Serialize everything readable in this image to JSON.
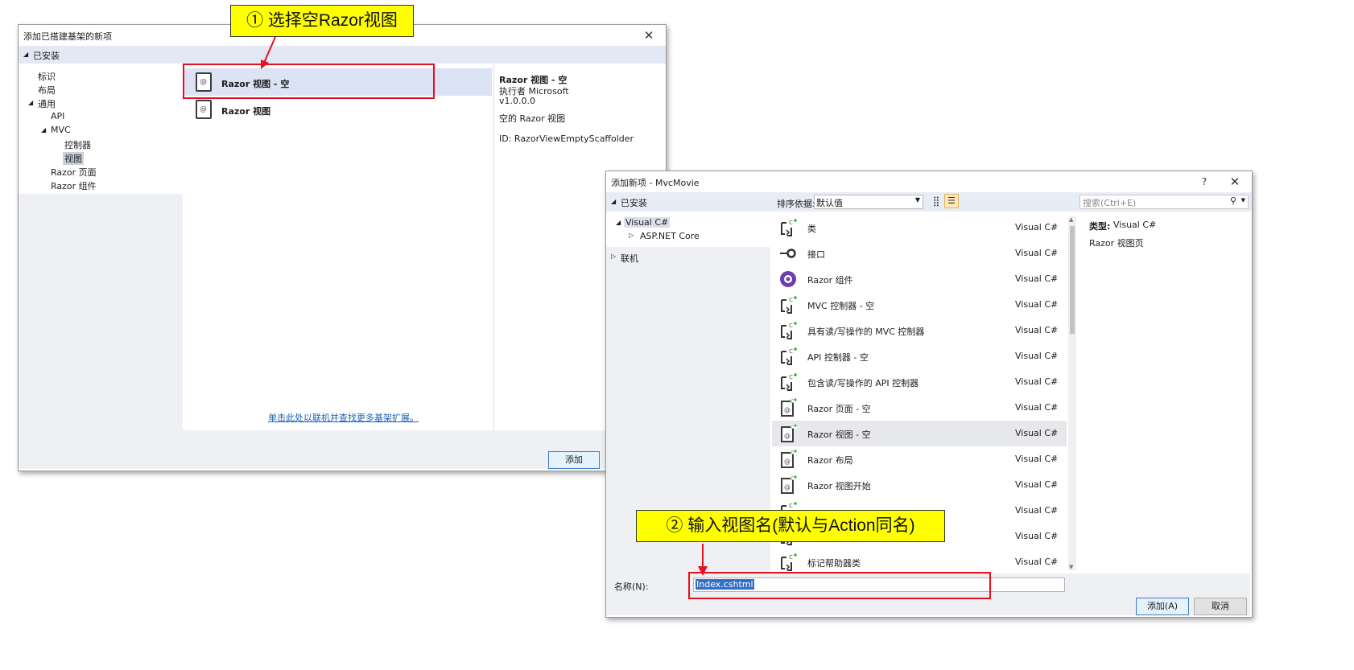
{
  "colors": {
    "accent_red": "#e8101c",
    "callout_yellow": "#ffff00",
    "selection_blue": "#dbe3f5",
    "link_blue": "#1a5fb4",
    "text_selection": "#3370c4"
  },
  "callouts": {
    "step1": "① 选择空Razor视图",
    "step2": "② 输入视图名(默认与Action同名)"
  },
  "scaffold": {
    "title": "添加已搭建基架的新项",
    "close_icon": "close-icon",
    "installed": "已安装",
    "tree": [
      "标识",
      "布局",
      "通用",
      "API",
      "MVC",
      "控制器",
      "视图",
      "Razor 页面",
      "Razor 组件"
    ],
    "items": [
      {
        "label": "Razor 视图 - 空",
        "icon": "razor-file-icon"
      },
      {
        "label": "Razor 视图",
        "icon": "razor-file-icon"
      }
    ],
    "detail": {
      "name": "Razor 视图 - 空",
      "author": "执行者 Microsoft",
      "version": "v1.0.0.0",
      "description": "空的 Razor 视图",
      "id": "ID: RazorViewEmptyScaffolder"
    },
    "online_link": "单击此处以联机并查找更多基架扩展。",
    "add_button": "添加"
  },
  "addnew": {
    "title": "添加新项 - MvcMovie",
    "help": "?",
    "close": "✕",
    "installed": "已安装",
    "sort_label": "排序依据:",
    "sort_value": "默认值",
    "search_placeholder": "搜索(Ctrl+E)",
    "tree": {
      "visual_csharp": "Visual C#",
      "aspnet_core": "ASP.NET Core",
      "online": "联机"
    },
    "templates": [
      {
        "name": "类",
        "lang": "Visual C#",
        "icon": "csharp-class-icon"
      },
      {
        "name": "接口",
        "lang": "Visual C#",
        "icon": "interface-icon"
      },
      {
        "name": "Razor 组件",
        "lang": "Visual C#",
        "icon": "blazor-icon"
      },
      {
        "name": "MVC 控制器 - 空",
        "lang": "Visual C#",
        "icon": "csharp-class-icon"
      },
      {
        "name": "具有读/写操作的 MVC 控制器",
        "lang": "Visual C#",
        "icon": "csharp-class-icon"
      },
      {
        "name": "API 控制器 - 空",
        "lang": "Visual C#",
        "icon": "csharp-class-icon"
      },
      {
        "name": "包含读/写操作的 API 控制器",
        "lang": "Visual C#",
        "icon": "csharp-class-icon"
      },
      {
        "name": "Razor 页面 - 空",
        "lang": "Visual C#",
        "icon": "razor-file-icon"
      },
      {
        "name": "Razor 视图 - 空",
        "lang": "Visual C#",
        "icon": "razor-file-icon"
      },
      {
        "name": "Razor 布局",
        "lang": "Visual C#",
        "icon": "razor-file-icon"
      },
      {
        "name": "Razor 视图开始",
        "lang": "Visual C#",
        "icon": "razor-file-icon"
      },
      {
        "name": "",
        "lang": "Visual C#",
        "icon": "csharp-class-icon"
      },
      {
        "name": "",
        "lang": "Visual C#",
        "icon": "csharp-class-icon"
      },
      {
        "name": "标记帮助器类",
        "lang": "Visual C#",
        "icon": "csharp-class-icon"
      }
    ],
    "selected_index": 8,
    "detail": {
      "type_label": "类型:",
      "type_value": "Visual C#",
      "description": "Razor 视图页"
    },
    "name_label": "名称(N):",
    "name_value": "Index.cshtml",
    "add_button": "添加(A)",
    "cancel_button": "取消"
  }
}
